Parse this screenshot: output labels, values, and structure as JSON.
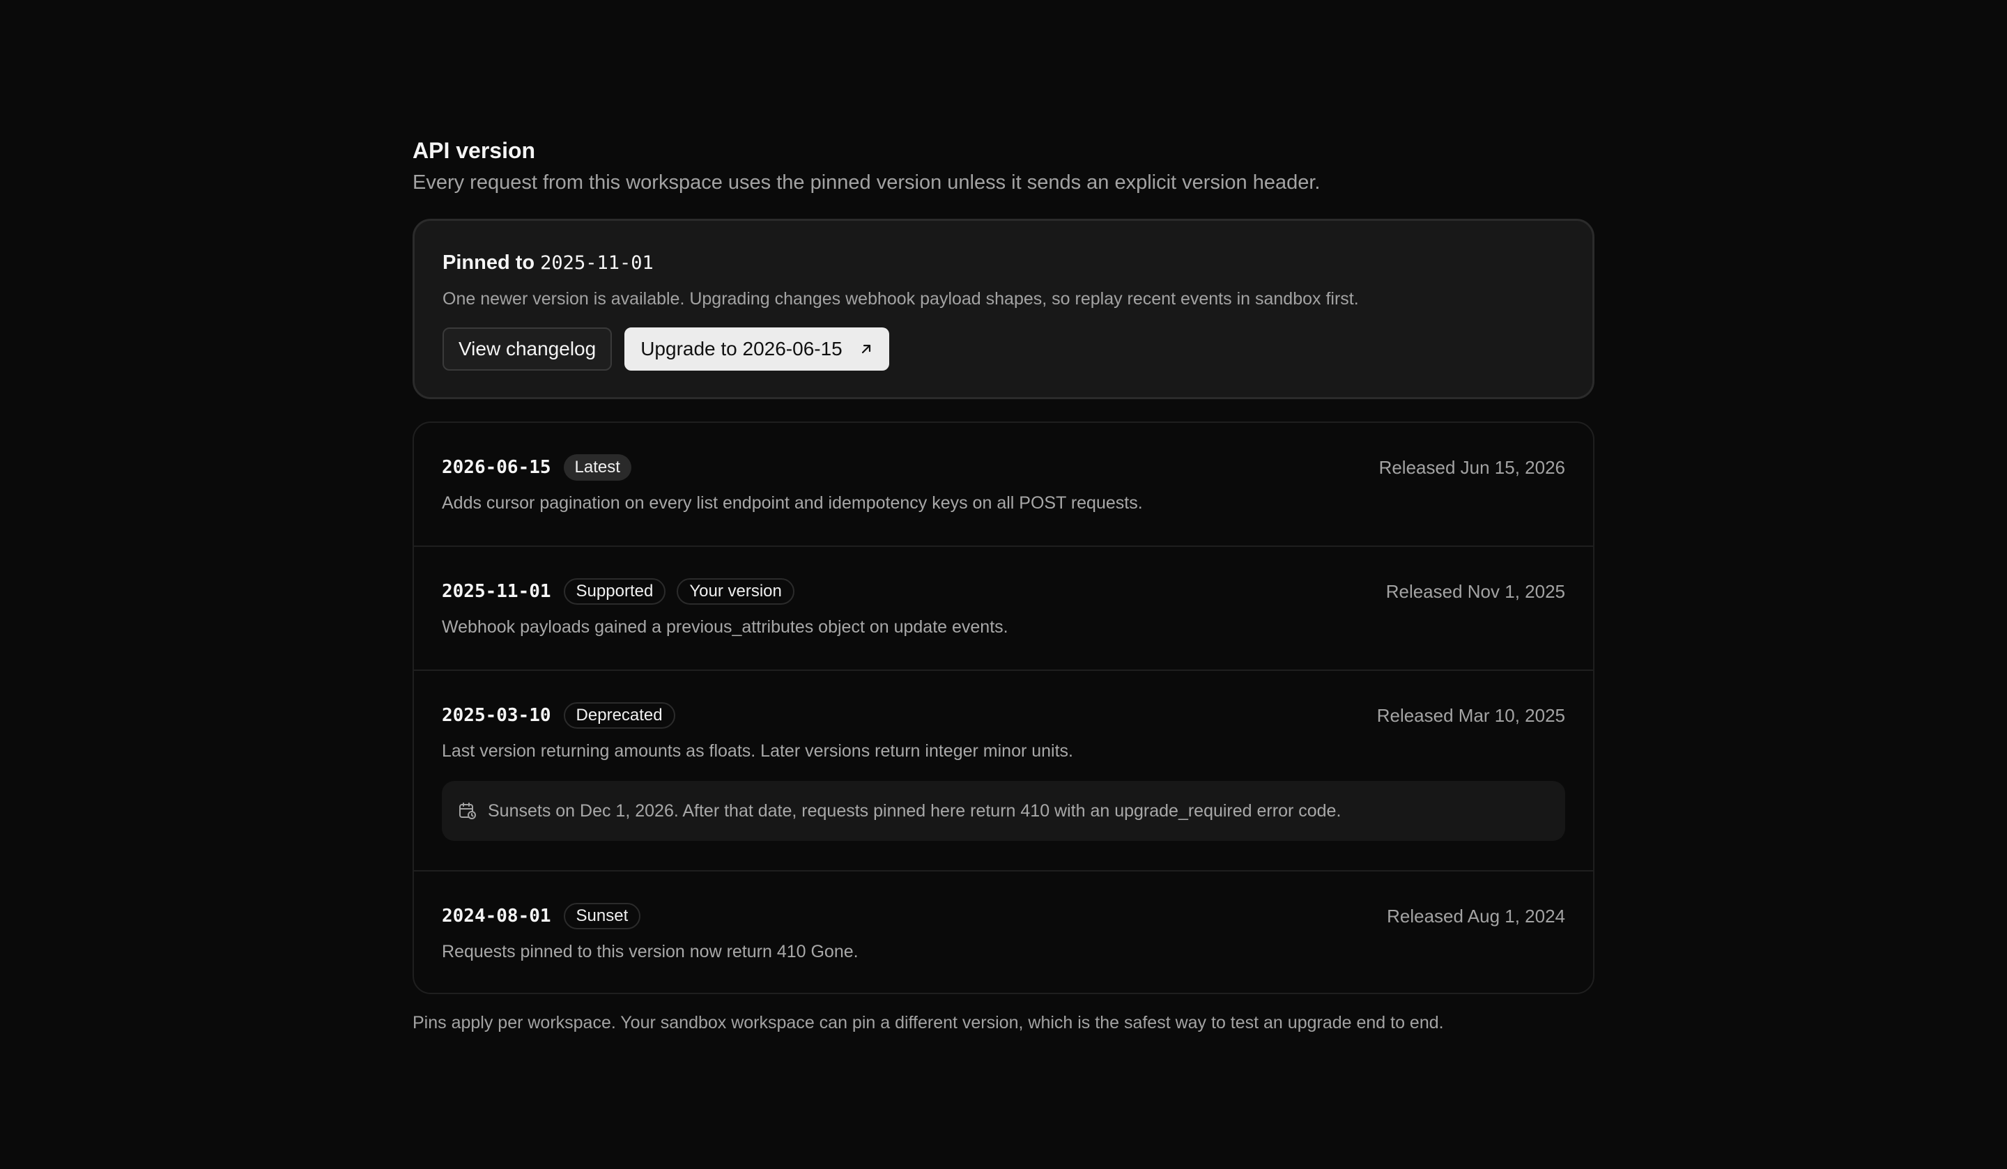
{
  "header": {
    "title": "API version",
    "subtitle": "Every request from this workspace uses the pinned version unless it sends an explicit version header."
  },
  "pinned": {
    "title_prefix": "Pinned to",
    "version": "2025-11-01",
    "description": "One newer version is available. Upgrading changes webhook payload shapes, so replay recent events in sandbox first.",
    "changelog_label": "View changelog",
    "upgrade_label": "Upgrade to 2026-06-15",
    "upgrade_icon": "arrow-up-right-icon"
  },
  "versions": [
    {
      "code": "2026-06-15",
      "badges": [
        "Latest"
      ],
      "released": "Released Jun 15, 2026",
      "description": "Adds cursor pagination on every list endpoint and idempotency keys on all POST requests."
    },
    {
      "code": "2025-11-01",
      "badges": [
        "Supported",
        "Your version"
      ],
      "released": "Released Nov 1, 2025",
      "description": "Webhook payloads gained a previous_attributes object on update events."
    },
    {
      "code": "2025-03-10",
      "badges": [
        "Deprecated"
      ],
      "released": "Released Mar 10, 2025",
      "description": "Last version returning amounts as floats. Later versions return integer minor units.",
      "notice": "Sunsets on Dec 1, 2026. After that date, requests pinned here return 410 with an upgrade_required error code.",
      "notice_icon": "calendar-clock-icon"
    },
    {
      "code": "2024-08-01",
      "badges": [
        "Sunset"
      ],
      "released": "Released Aug 1, 2024",
      "description": "Requests pinned to this version now return 410 Gone."
    }
  ],
  "footnote": "Pins apply per workspace. Your sandbox workspace can pin a different version, which is the safest way to test an upgrade end to end.",
  "colors": {
    "background": "#0a0a0a",
    "card": "#181818",
    "primary_button": "#ececec",
    "muted_text": "#a3a3a3"
  }
}
